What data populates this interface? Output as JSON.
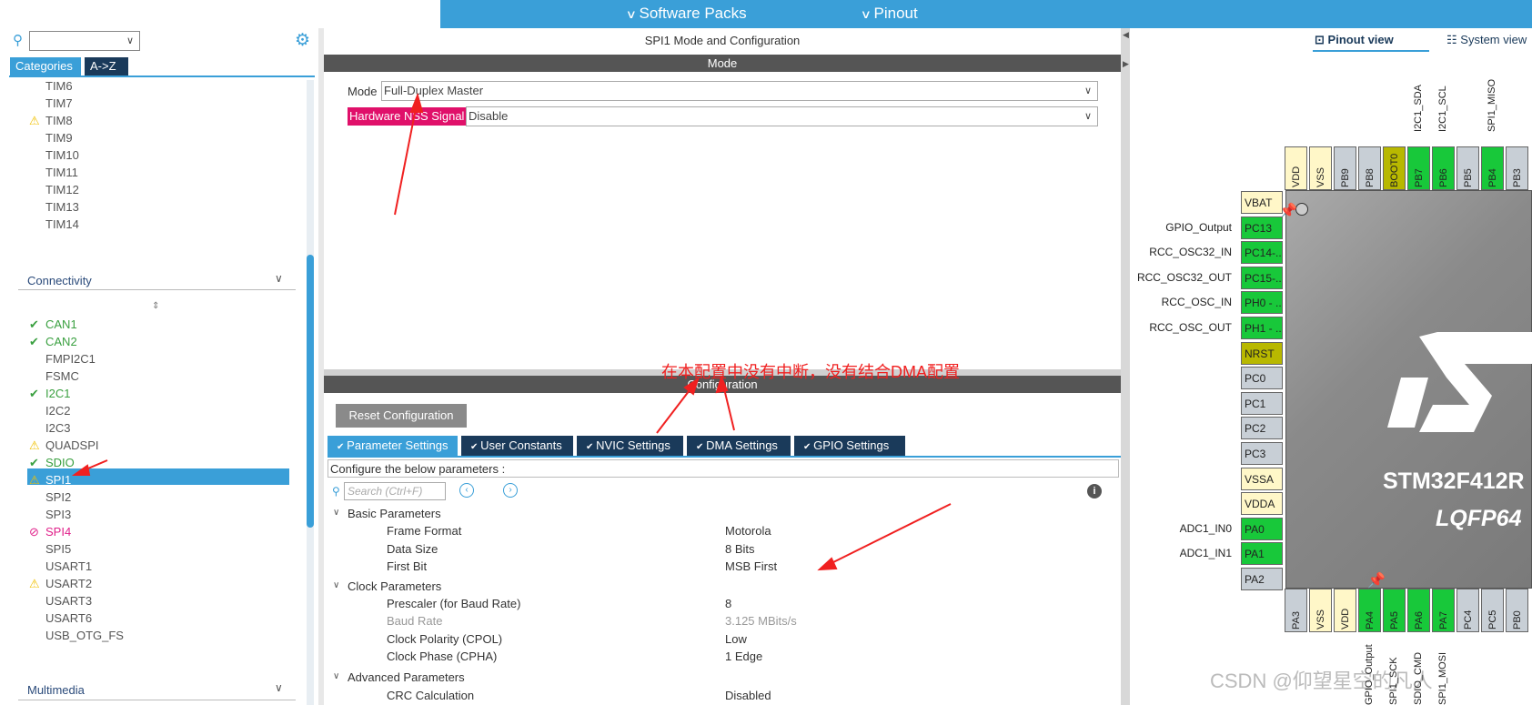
{
  "topbar": {
    "software_packs": "Software Packs",
    "pinout": "Pinout"
  },
  "left": {
    "search_placeholder": "",
    "tabs": {
      "categories": "Categories",
      "az": "A->Z"
    },
    "timers": [
      "TIM6",
      "TIM7",
      "TIM8",
      "TIM9",
      "TIM10",
      "TIM11",
      "TIM12",
      "TIM13",
      "TIM14"
    ],
    "connectivity_label": "Connectivity",
    "connectivity": [
      {
        "name": "CAN1",
        "status": "ok"
      },
      {
        "name": "CAN2",
        "status": "ok"
      },
      {
        "name": "FMPI2C1",
        "status": "none"
      },
      {
        "name": "FSMC",
        "status": "none"
      },
      {
        "name": "I2C1",
        "status": "ok"
      },
      {
        "name": "I2C2",
        "status": "none"
      },
      {
        "name": "I2C3",
        "status": "none"
      },
      {
        "name": "QUADSPI",
        "status": "warn"
      },
      {
        "name": "SDIO",
        "status": "ok"
      },
      {
        "name": "SPI1",
        "status": "warn-selected"
      },
      {
        "name": "SPI2",
        "status": "none"
      },
      {
        "name": "SPI3",
        "status": "none"
      },
      {
        "name": "SPI4",
        "status": "err"
      },
      {
        "name": "SPI5",
        "status": "none"
      },
      {
        "name": "USART1",
        "status": "none"
      },
      {
        "name": "USART2",
        "status": "warn"
      },
      {
        "name": "USART3",
        "status": "none"
      },
      {
        "name": "USART6",
        "status": "none"
      },
      {
        "name": "USB_OTG_FS",
        "status": "none"
      }
    ],
    "multimedia_label": "Multimedia"
  },
  "center": {
    "title": "SPI1 Mode and Configuration",
    "mode_header": "Mode",
    "mode_label": "Mode",
    "mode_value": "Full-Duplex Master",
    "nss_label": "Hardware NSS Signal",
    "nss_value": "Disable",
    "config_header": "Configuration",
    "reset_button": "Reset Configuration",
    "tabs": [
      "Parameter Settings",
      "User Constants",
      "NVIC Settings",
      "DMA Settings",
      "GPIO Settings"
    ],
    "configure_text": "Configure the below parameters :",
    "search_placeholder": "Search (Ctrl+F)",
    "groups": {
      "basic": "Basic Parameters",
      "clock": "Clock Parameters",
      "advanced": "Advanced Parameters"
    },
    "params": [
      {
        "name": "Frame Format",
        "value": "Motorola"
      },
      {
        "name": "Data Size",
        "value": "8 Bits"
      },
      {
        "name": "First Bit",
        "value": "MSB First"
      },
      {
        "name": "Prescaler (for Baud Rate)",
        "value": "8"
      },
      {
        "name": "Baud Rate",
        "value": "3.125 MBits/s"
      },
      {
        "name": "Clock Polarity (CPOL)",
        "value": "Low"
      },
      {
        "name": "Clock Phase (CPHA)",
        "value": "1 Edge"
      },
      {
        "name": "CRC Calculation",
        "value": "Disabled"
      }
    ],
    "annotation": "在本配置中没有中断，没有结合DMA配置"
  },
  "right": {
    "pinout_view": "Pinout view",
    "system_view": "System view",
    "chip_name": "STM32F412R",
    "chip_package": "LQFP64",
    "top_pins": [
      "VDD",
      "VSS",
      "PB9",
      "PB8",
      "BOOT0",
      "PB7",
      "PB6",
      "PB5",
      "PB4",
      "PB3"
    ],
    "top_labels": {
      "pb7": "I2C1_SDA",
      "pb6": "I2C1_SCL",
      "pb4": "SPI1_MISO"
    },
    "left_pins": [
      "VBAT",
      "PC13",
      "PC14-..",
      "PC15-..",
      "PH0 - ..",
      "PH1 - ..",
      "NRST",
      "PC0",
      "PC1",
      "PC2",
      "PC3",
      "VSSA",
      "VDDA",
      "PA0",
      "PA1",
      "PA2"
    ],
    "left_labels": {
      "pc13": "GPIO_Output",
      "pc14": "RCC_OSC32_IN",
      "pc15": "RCC_OSC32_OUT",
      "ph0": "RCC_OSC_IN",
      "ph1": "RCC_OSC_OUT",
      "pa0": "ADC1_IN0",
      "pa1": "ADC1_IN1"
    },
    "bottom_pins": [
      "PA3",
      "VSS",
      "VDD",
      "PA4",
      "PA5",
      "PA6",
      "PA7",
      "PC4",
      "PC5",
      "PB0"
    ],
    "bottom_labels": {
      "pa4": "GPIO_Output",
      "pa5": "SPI1_SCK",
      "pa6": "SDIO_CMD",
      "pa7": "SPI1_MOSI"
    },
    "watermark": "CSDN @仰望星空的凡人"
  }
}
